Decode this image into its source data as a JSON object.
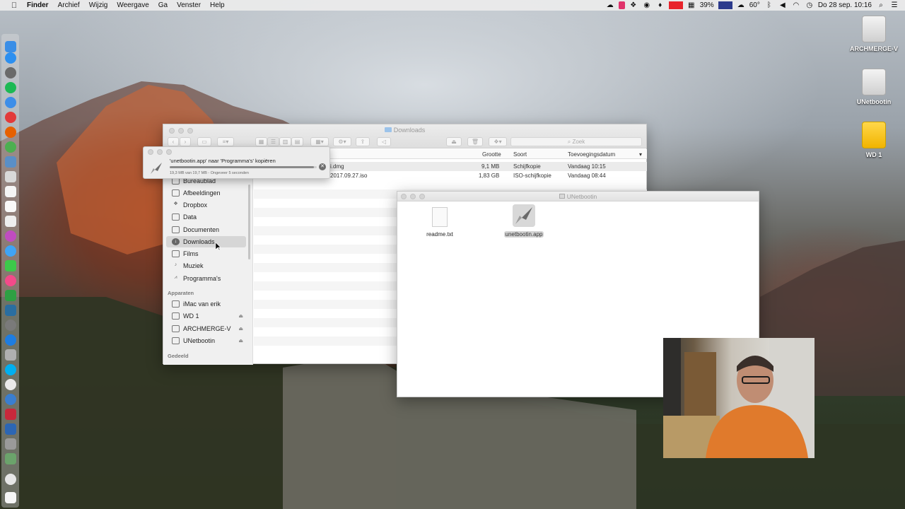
{
  "menubar": {
    "apple": "",
    "items": [
      "Finder",
      "Archief",
      "Wijzig",
      "Weergave",
      "Ga",
      "Venster",
      "Help"
    ],
    "battery": "39%",
    "temperature": "60°",
    "datetime": "Do 28 sep.  10:16"
  },
  "desktop": {
    "icons": [
      {
        "label": "ARCHMERGE-V"
      },
      {
        "label": "UNetbootin"
      },
      {
        "label": "WD 1"
      }
    ]
  },
  "downloads_window": {
    "title": "Downloads",
    "search_placeholder": "Zoek",
    "columns": {
      "size": "Grootte",
      "kind": "Soort",
      "date": "Toevoegingsdatum"
    },
    "files": [
      {
        "name": "…i.dmg",
        "size": "9,1 MB",
        "kind": "Schijfkopie",
        "date": "Vandaag 10:15"
      },
      {
        "name": "…2017.09.27.iso",
        "size": "1,83 GB",
        "kind": "ISO-schijfkopie",
        "date": "Vandaag 08:44"
      }
    ],
    "sidebar": {
      "favorites": [
        {
          "label": "Bureaublad"
        },
        {
          "label": "Afbeeldingen"
        },
        {
          "label": "Dropbox"
        },
        {
          "label": "Data"
        },
        {
          "label": "Documenten"
        },
        {
          "label": "Downloads"
        },
        {
          "label": "Films"
        },
        {
          "label": "Muziek"
        },
        {
          "label": "Programma's"
        }
      ],
      "devices_heading": "Apparaten",
      "devices": [
        {
          "label": "iMac van erik"
        },
        {
          "label": "WD 1"
        },
        {
          "label": "ARCHMERGE-V"
        },
        {
          "label": "UNetbootin"
        }
      ],
      "shared_heading": "Gedeeld"
    }
  },
  "copy_dialog": {
    "title": "'unetbootin.app' naar 'Programma's' kopiëren",
    "status": "19,3 MB van 19,7 MB - Ongeveer 5 seconden",
    "progress": 0.98
  },
  "unetbootin_window": {
    "title": "UNetbootin",
    "files": [
      {
        "name": "readme.txt"
      },
      {
        "name": "unetbootin.app"
      }
    ]
  }
}
